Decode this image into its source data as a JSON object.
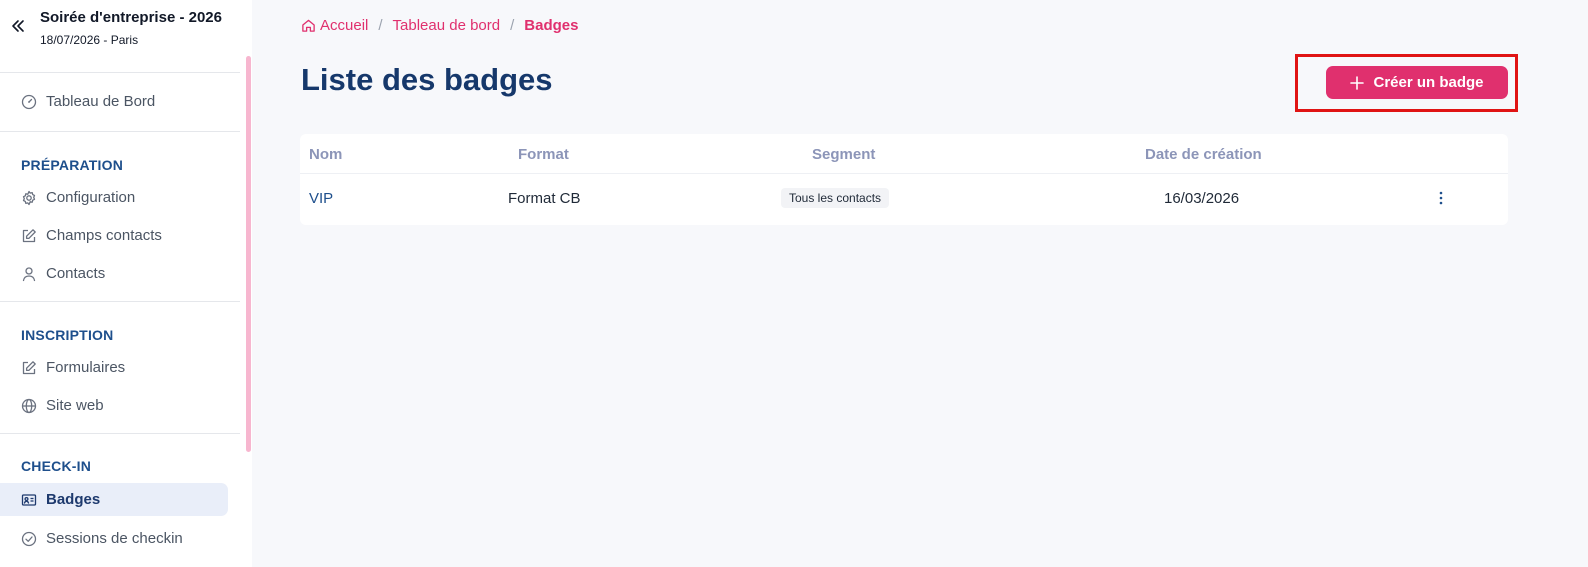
{
  "event": {
    "title": "Soirée d'entreprise - 2026",
    "subtitle": "18/07/2026 - Paris"
  },
  "sidebar": {
    "dashboard": "Tableau de Bord",
    "sections": [
      {
        "title": "PRÉPARATION",
        "items": [
          "Configuration",
          "Champs contacts",
          "Contacts"
        ]
      },
      {
        "title": "INSCRIPTION",
        "items": [
          "Formulaires",
          "Site web"
        ]
      },
      {
        "title": "CHECK-IN",
        "items": [
          "Badges",
          "Sessions de checkin"
        ]
      }
    ],
    "active_item": "Badges"
  },
  "breadcrumb": {
    "home": "Accueil",
    "parent": "Tableau de bord",
    "current": "Badges"
  },
  "page": {
    "title": "Liste des badges",
    "create_button": "Créer un badge"
  },
  "table": {
    "columns": [
      "Nom",
      "Format",
      "Segment",
      "Date de création"
    ],
    "rows": [
      {
        "name": "VIP",
        "format": "Format CB",
        "segment": "Tous les contacts",
        "created": "16/03/2026"
      }
    ]
  },
  "colors": {
    "accent": "#e0306e",
    "primary": "#16386b",
    "highlight": "#e01414"
  }
}
